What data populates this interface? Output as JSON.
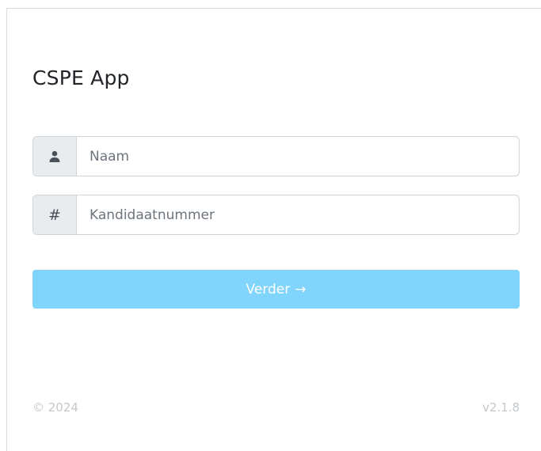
{
  "app": {
    "title": "CSPE App"
  },
  "form": {
    "name_placeholder": "Naam",
    "name_icon": "user-icon",
    "number_placeholder": "Kandidaatnummer",
    "number_icon": "hash-icon",
    "number_icon_glyph": "#",
    "submit_label": "Verder",
    "submit_arrow": "→"
  },
  "footer": {
    "copyright": "© 2024",
    "version": "v2.1.8"
  },
  "colors": {
    "primary_disabled": "#81d4fb",
    "addon_bg": "#e9ecef"
  }
}
